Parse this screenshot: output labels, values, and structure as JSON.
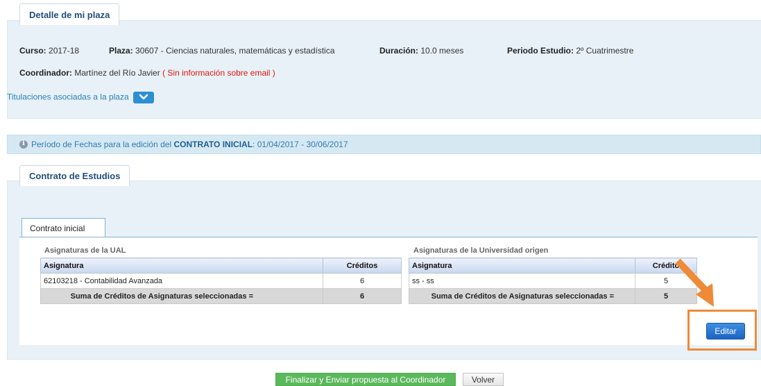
{
  "plaza": {
    "title": "Detalle de mi plaza",
    "curso_label": "Curso:",
    "curso_value": "2017-18",
    "plaza_label": "Plaza:",
    "plaza_value": "30607 - Ciencias naturales, matemáticas y estadística",
    "duracion_label": "Duración:",
    "duracion_value": "10.0 meses",
    "periodo_label": "Periodo Estudio:",
    "periodo_value": "2º Cuatrimestre",
    "coordinador_label": "Coordinador:",
    "coordinador_value": "Martínez del Río Javier",
    "coordinador_note": "( Sin información sobre email )",
    "titulaciones_link": "Titulaciones asociadas a la plaza"
  },
  "info_bar": {
    "prefix": "Período de Fechas para la edición del",
    "highlight": "CONTRATO INICIAL",
    "suffix": ": 01/04/2017 - 30/06/2017"
  },
  "contrato": {
    "title": "Contrato de Estudios",
    "tab_label": "Contrato inicial",
    "ual": {
      "caption": "Asignaturas de la UAL",
      "headers": [
        "Asignatura",
        "Créditos"
      ],
      "rows": [
        [
          "62103218 - Contabilidad Avanzada",
          "6"
        ]
      ],
      "sum_label": "Suma de Créditos de Asignaturas seleccionadas =",
      "sum_value": "6"
    },
    "origen": {
      "caption": "Asignaturas de la Universidad origen",
      "headers": [
        "Asignatura",
        "Crédito"
      ],
      "rows": [
        [
          "ss - ss",
          "5"
        ]
      ],
      "sum_label": "Suma de Créditos de Asignaturas seleccionadas =",
      "sum_value": "5"
    },
    "editar_label": "Editar"
  },
  "footer": {
    "finalizar_label": "Finalizar y Enviar propuesta al Coordinador",
    "volver_label": "Volver"
  },
  "colors": {
    "panel_bg": "#e8f1f7",
    "title_blue": "#1f4e79",
    "link_blue": "#2a7fb8",
    "warning_red": "#e0180c",
    "annotation_orange": "#ef8a38",
    "primary_button": "#1b64c4",
    "success_button": "#5cb85c"
  },
  "icons": [
    "chevron-down-icon",
    "info-icon",
    "annotation-arrow-icon"
  ]
}
